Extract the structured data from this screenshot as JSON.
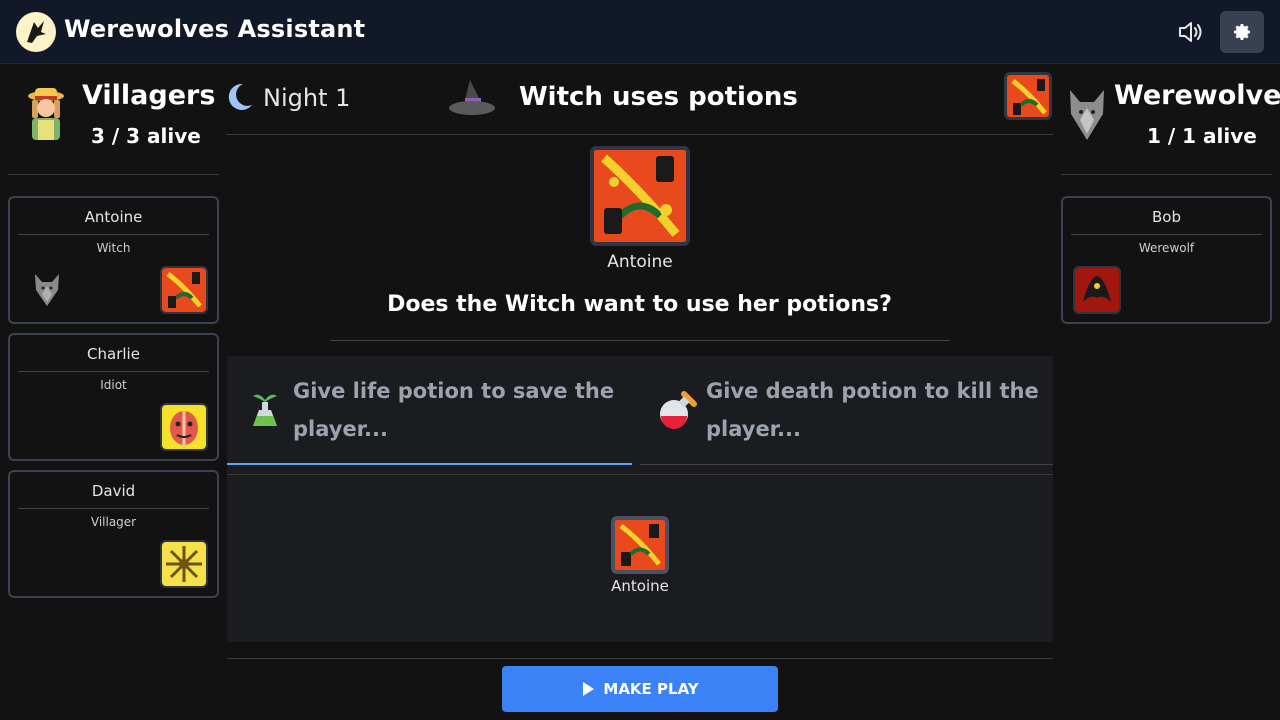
{
  "app": {
    "title": "Werewolves Assistant"
  },
  "villagers": {
    "name": "Villagers",
    "alive": "3 / 3 alive"
  },
  "werewolves": {
    "name": "Werewolves",
    "alive": "1 / 1 alive"
  },
  "phase": {
    "label": "Night 1"
  },
  "step": {
    "title": "Witch uses potions"
  },
  "players_left": [
    {
      "name": "Antoine",
      "role": "Witch"
    },
    {
      "name": "Charlie",
      "role": "Idiot"
    },
    {
      "name": "David",
      "role": "Villager"
    }
  ],
  "players_right": [
    {
      "name": "Bob",
      "role": "Werewolf"
    }
  ],
  "main": {
    "player_name": "Antoine",
    "question": "Does the Witch want to use her potions?",
    "tabs": [
      {
        "label": "Give life potion to save the player...",
        "active": true
      },
      {
        "label": "Give death potion to kill the player...",
        "active": false
      }
    ],
    "target_name": "Antoine"
  },
  "actions": {
    "make_play": "MAKE PLAY"
  },
  "colors": {
    "accent": "#3b82f6",
    "tab_active": "#60a5fa",
    "topbar": "#111827"
  },
  "icons": {
    "logo": "wolf-logo-icon",
    "sound": "speaker-icon",
    "settings": "gear-icon",
    "night": "moon-icon",
    "witch": "witch-hat-icon",
    "life_potion": "life-potion-icon",
    "death_potion": "death-potion-icon",
    "play": "play-icon"
  }
}
